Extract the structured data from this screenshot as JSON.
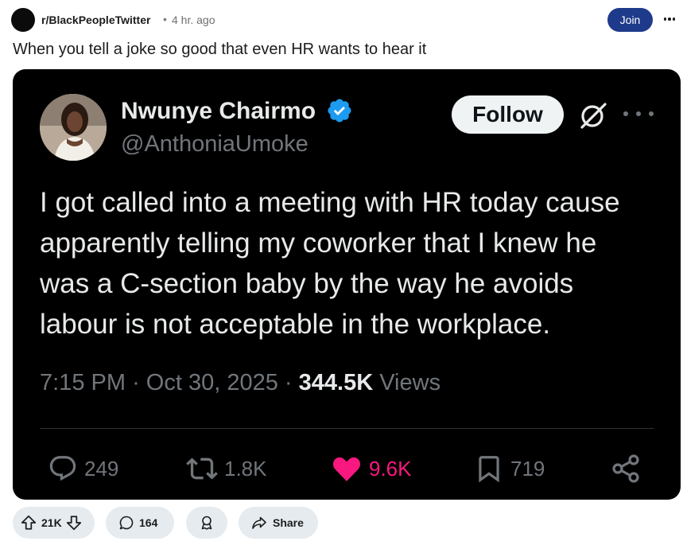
{
  "post": {
    "subreddit": "r/BlackPeopleTwitter",
    "separator": "•",
    "time_ago": "4 hr. ago",
    "join_label": "Join",
    "title": "When you tell a joke so good that even HR wants to hear it"
  },
  "tweet": {
    "display_name": "Nwunye Chairmo",
    "handle": "@AnthoniaUmoke",
    "follow_label": "Follow",
    "text_lines": [
      "I got called into a meeting with HR today cause",
      "apparently telling my  coworker that I knew he",
      "was a C-section baby by the way he avoids",
      "labour is not acceptable in the workplace."
    ],
    "time": "7:15 PM",
    "date": "Oct 30, 2025",
    "meta_separator": "·",
    "views_count": "344.5K",
    "views_label": "Views",
    "replies": "249",
    "reposts": "1.8K",
    "likes": "9.6K",
    "bookmarks": "719",
    "colors": {
      "like": "#f91880",
      "verified": "#1d9bf0",
      "background": "#000000"
    },
    "icons": [
      "verified-badge-icon",
      "grok-icon",
      "more-icon",
      "reply-icon",
      "repost-icon",
      "heart-icon",
      "bookmark-icon",
      "share-icon"
    ]
  },
  "reddit_actions": {
    "upvotes": "21K",
    "comments": "164",
    "share_label": "Share",
    "icons": [
      "upvote-icon",
      "downvote-icon",
      "comment-icon",
      "award-icon",
      "share-arrow-icon"
    ],
    "colors": {
      "join": "#1e3a8a",
      "pill": "#e5ebee"
    }
  }
}
